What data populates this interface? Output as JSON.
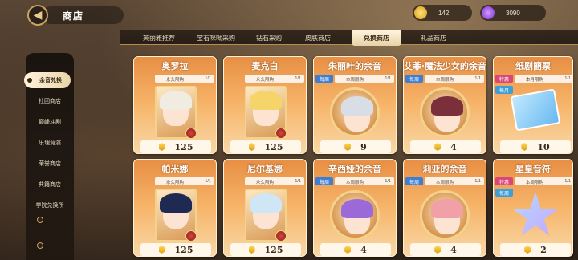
{
  "header": {
    "title": "商店",
    "back_icon": "back-arrow-icon"
  },
  "currency": [
    {
      "name": "gold-coin",
      "value": "142",
      "color": "#f2b21d"
    },
    {
      "name": "purple-crystal",
      "value": "3090",
      "color": "#9b4cf0"
    }
  ],
  "tabs": [
    {
      "label": "芙丽雅推荐",
      "active": false
    },
    {
      "label": "宝石咪呦采购",
      "active": false
    },
    {
      "label": "钻石采购",
      "active": false
    },
    {
      "label": "皮肤商店",
      "active": false
    },
    {
      "label": "兑换商店",
      "active": true
    },
    {
      "label": "礼品商店",
      "active": false
    }
  ],
  "sidebar": {
    "items": [
      {
        "label": "余音兑换",
        "active": true
      },
      {
        "label": "社团商店",
        "active": false
      },
      {
        "label": "巅峰斗剧",
        "active": false
      },
      {
        "label": "乐理竞演",
        "active": false
      },
      {
        "label": "荣誉商店",
        "active": false
      },
      {
        "label": "典籍商店",
        "active": false
      },
      {
        "label": "学院兑换所",
        "active": false
      }
    ]
  },
  "cards": [
    {
      "title": "奥罗拉",
      "tag": "",
      "limit_label": "永久限购",
      "limit": "1/1",
      "price": "125",
      "art": "frame",
      "hair": "#f1ece2",
      "face": "#fde3d2"
    },
    {
      "title": "麦克白",
      "tag": "",
      "limit_label": "永久限购",
      "limit": "1/1",
      "price": "125",
      "art": "frame",
      "hair": "#f5d46a",
      "face": "#fde3d2"
    },
    {
      "title": "朱丽叶的余音",
      "tag": "每周",
      "limit_label": "本周限购",
      "limit": "1/1",
      "price": "9",
      "art": "medal",
      "hair": "#d9dde6",
      "face": "#fde3d2"
    },
    {
      "title": "艾菲·魔法少女的余音",
      "tag": "每周",
      "limit_label": "本周限购",
      "limit": "1/1",
      "price": "4",
      "art": "medal",
      "hair": "#7a2f3a",
      "face": "#fde3d2"
    },
    {
      "title": "纸剧簡票",
      "tag": "特惠",
      "tag2": "每月",
      "limit_label": "本月限购",
      "limit": "1/1",
      "price": "10",
      "art": "ticket"
    },
    {
      "title": "帕米娜",
      "tag": "",
      "limit_label": "永久限购",
      "limit": "1/1",
      "price": "125",
      "art": "frame",
      "hair": "#1f2a52",
      "face": "#fde3d2"
    },
    {
      "title": "尼尔基娜",
      "tag": "",
      "limit_label": "永久限购",
      "limit": "1/1",
      "price": "125",
      "art": "frame",
      "hair": "#cfe6f5",
      "face": "#fde3d2"
    },
    {
      "title": "辛西娅的余音",
      "tag": "每周",
      "limit_label": "本周限购",
      "limit": "1/1",
      "price": "4",
      "art": "medal",
      "hair": "#9b6ad8",
      "face": "#fde3d2"
    },
    {
      "title": "莉亚的余音",
      "tag": "每周",
      "limit_label": "本周限购",
      "limit": "1/1",
      "price": "4",
      "art": "medal",
      "hair": "#f0a0a6",
      "face": "#fde3d2"
    },
    {
      "title": "星皇音符",
      "tag": "特惠",
      "tag2": "每周",
      "limit_label": "本周限购",
      "limit": "1/1",
      "price": "2",
      "art": "star"
    }
  ]
}
